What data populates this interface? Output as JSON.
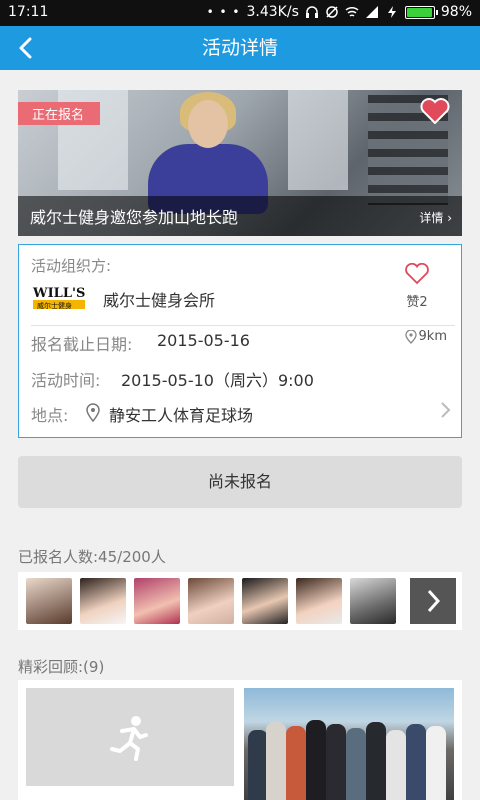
{
  "status_bar": {
    "time": "17:11",
    "dots": "• • •",
    "speed": "3.43K/s",
    "battery": "98%",
    "battery_level": 0.98
  },
  "nav": {
    "title": "活动详情",
    "back_icon": "back-arrow-icon"
  },
  "banner": {
    "badge": "正在报名",
    "caption": "威尔士健身邀您参加山地长跑",
    "detail_link": "详情 ›"
  },
  "event": {
    "organizer_label": "活动组织方:",
    "organizer_name": "威尔士健身会所",
    "logo_text": "WILL'S",
    "logo_subtext": "威尔士健身",
    "like_label": "赞2",
    "deadline_label": "报名截止日期:",
    "deadline_value": "2015-05-16",
    "distance": "9km",
    "time_label": "活动时间:",
    "time_value": "2015-05-10（周六）9:00",
    "location_label": "地点:",
    "location_value": "静安工人体育足球场"
  },
  "signup": {
    "button_label": "尚未报名"
  },
  "participants": {
    "label": "已报名人数:45/200人",
    "avatars": [
      "avatar-1",
      "avatar-2",
      "avatar-3",
      "avatar-4",
      "avatar-5",
      "avatar-6",
      "avatar-7"
    ]
  },
  "gallery": {
    "label": "精彩回顾:(9)"
  },
  "colors": {
    "accent": "#1e9ae0",
    "badge": "#ea6b73",
    "heart": "#e04a5a",
    "card_border": "#35a3e0"
  }
}
